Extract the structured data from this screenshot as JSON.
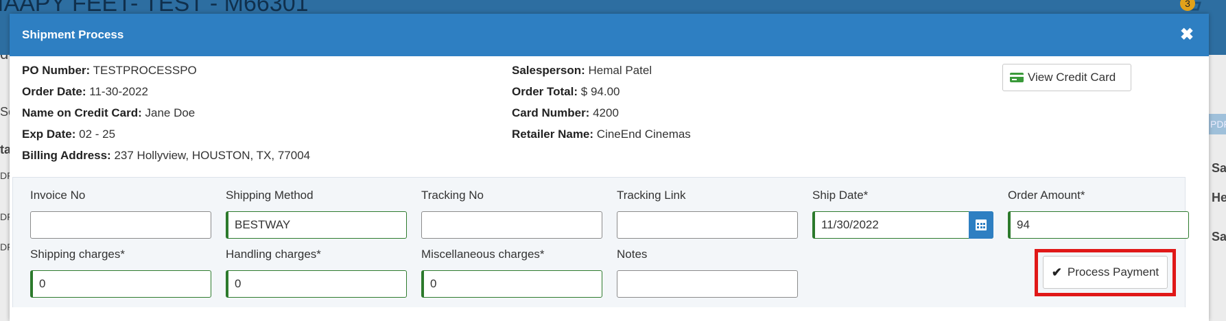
{
  "background": {
    "page_title": "IAAPY FEET- TEST - M66301",
    "cart_count": "3",
    "left_fragments": [
      "d",
      "Se",
      "ta",
      "DF",
      "DF",
      "DF"
    ],
    "right_fragments": [
      "PDF",
      "Sa",
      "He",
      "Sa"
    ]
  },
  "modal": {
    "title": "Shipment Process",
    "close_icon": "close-icon",
    "info_left": [
      {
        "label": "PO Number:",
        "value": "TESTPROCESSPO"
      },
      {
        "label": "Order Date:",
        "value": "11-30-2022"
      },
      {
        "label": "Name on Credit Card:",
        "value": "Jane Doe"
      },
      {
        "label": "Exp Date:",
        "value": "02 - 25"
      },
      {
        "label": "Billing Address:",
        "value": "237 Hollyview, HOUSTON, TX, 77004"
      }
    ],
    "info_right": [
      {
        "label": "Salesperson:",
        "value": "Hemal Patel"
      },
      {
        "label": "Order Total:",
        "value": "$ 94.00"
      },
      {
        "label": "Card Number:",
        "value": "4200"
      },
      {
        "label": "Retailer Name:",
        "value": "CineEnd Cinemas"
      }
    ],
    "view_credit_card_label": "View Credit Card",
    "form": {
      "invoice_no": {
        "label": "Invoice No",
        "value": ""
      },
      "shipping_method": {
        "label": "Shipping Method",
        "value": "BESTWAY"
      },
      "tracking_no": {
        "label": "Tracking No",
        "value": ""
      },
      "tracking_link": {
        "label": "Tracking Link",
        "value": ""
      },
      "ship_date": {
        "label": "Ship Date*",
        "value": "11/30/2022"
      },
      "order_amount": {
        "label": "Order Amount*",
        "value": "94"
      },
      "shipping_charges": {
        "label": "Shipping charges*",
        "value": "0"
      },
      "handling_charges": {
        "label": "Handling charges*",
        "value": "0"
      },
      "misc_charges": {
        "label": "Miscellaneous charges*",
        "value": "0"
      },
      "notes": {
        "label": "Notes",
        "value": ""
      }
    },
    "process_payment_label": "Process Payment"
  },
  "colors": {
    "header_blue": "#2e7fc2",
    "valid_green": "#2c7a2c",
    "highlight_red": "#e01818",
    "cc_icon_green": "#3a9a3a"
  }
}
